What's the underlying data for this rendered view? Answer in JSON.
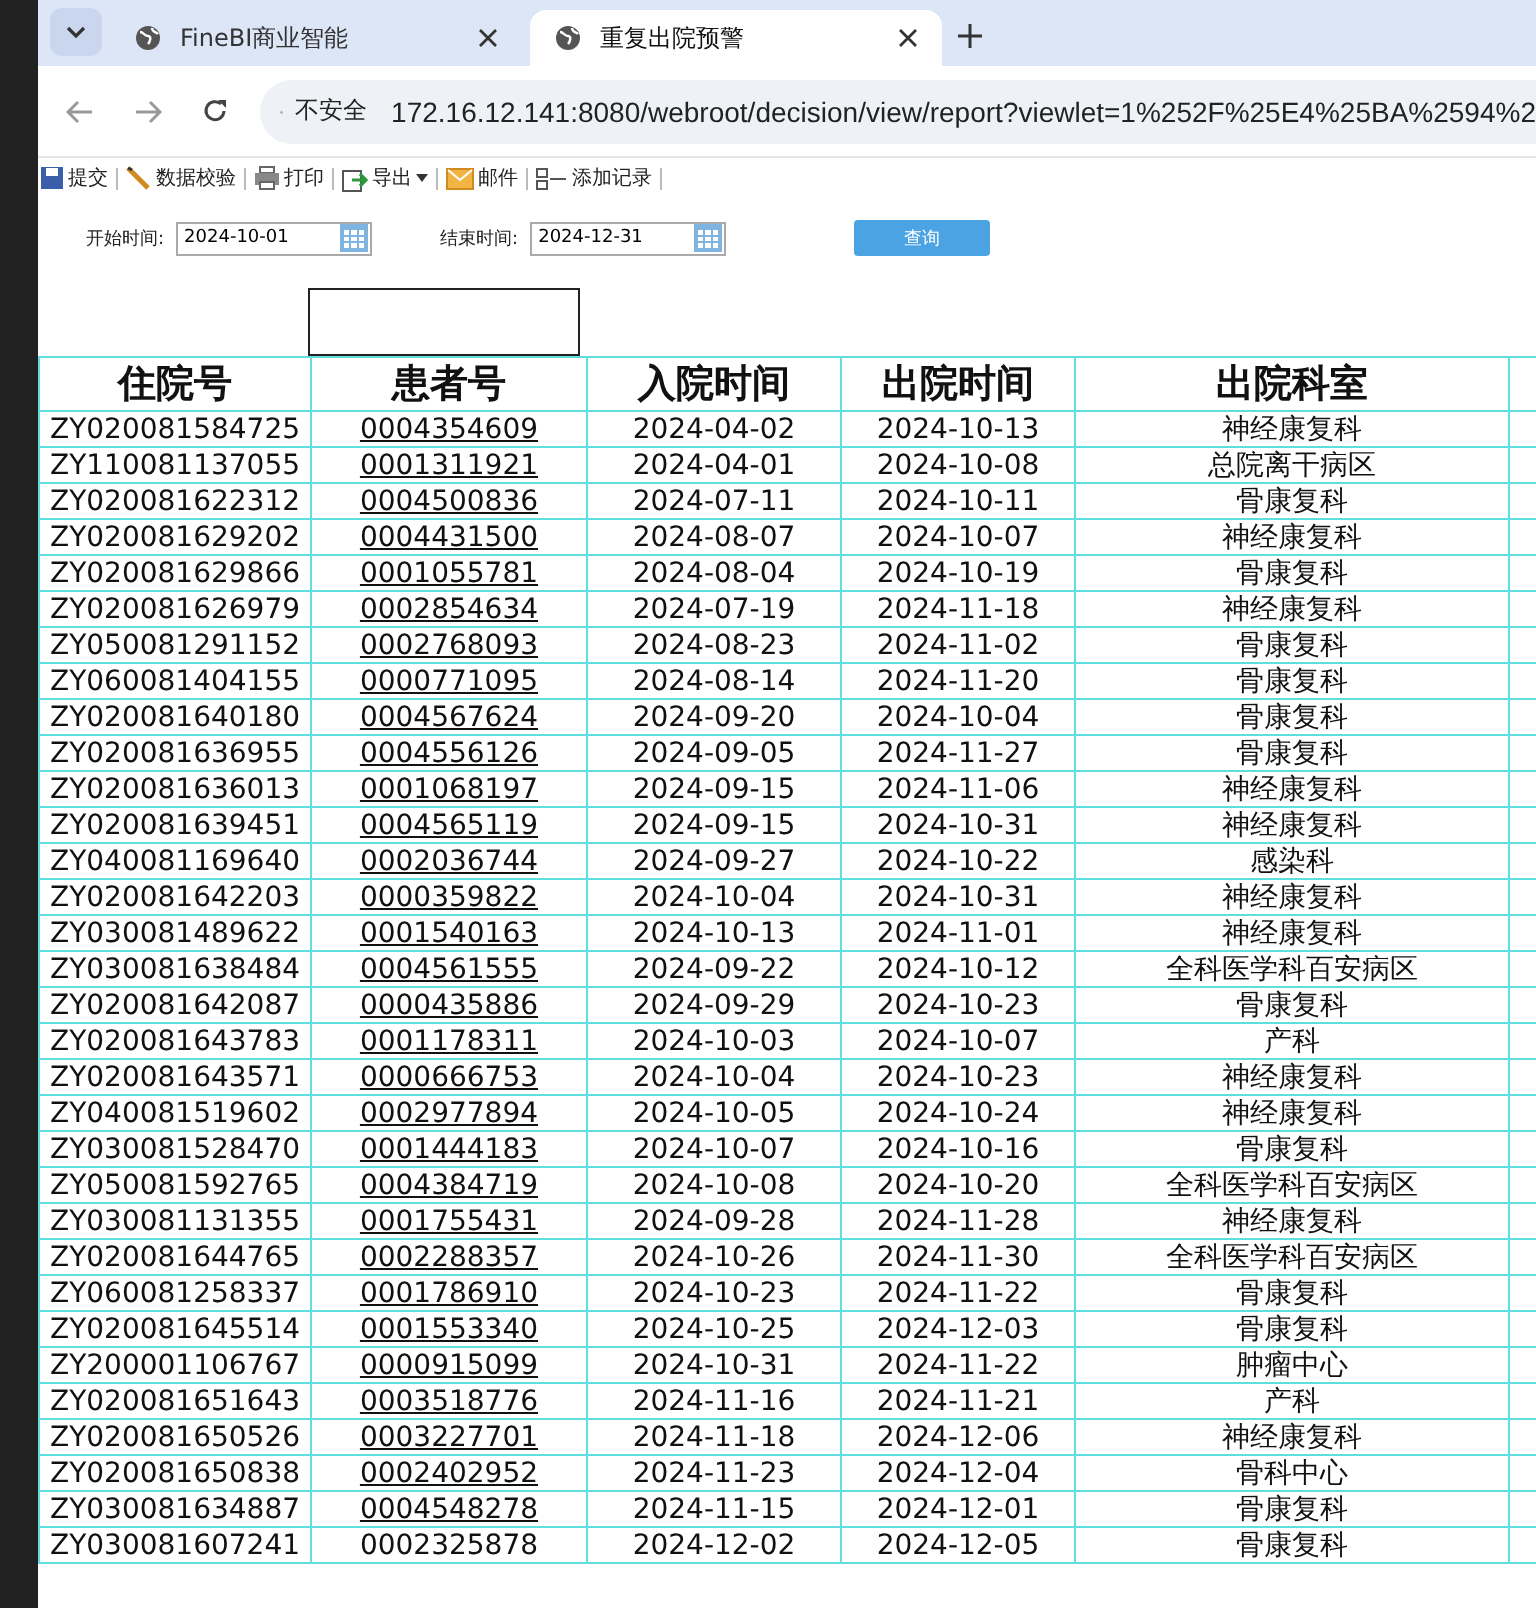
{
  "browser": {
    "tabs": [
      {
        "title": "FineBI商业智能",
        "selected": false
      },
      {
        "title": "重复出院预警",
        "selected": true
      }
    ],
    "security_label": "不安全",
    "url": "172.16.12.141:8080/webroot/decision/view/report?viewlet=1%252F%25E4%25BA%2594%2"
  },
  "toolbar": [
    {
      "kind": "save",
      "label": "提交"
    },
    {
      "kind": "check",
      "label": "数据校验"
    },
    {
      "kind": "print",
      "label": "打印"
    },
    {
      "kind": "export",
      "label": "导出",
      "dropdown": true
    },
    {
      "kind": "mail",
      "label": "邮件"
    },
    {
      "kind": "add",
      "label": "添加记录"
    }
  ],
  "filters": [
    {
      "label": "开始时间:",
      "value": "2024-10-01"
    },
    {
      "label": "结束时间:",
      "value": "2024-12-31"
    }
  ],
  "query_button": "查询",
  "table": {
    "columns": [
      "住院号",
      "患者号",
      "入院时间",
      "出院时间",
      "出院科室"
    ],
    "rows": [
      {
        "cells": [
          "ZY020081584725",
          "0004354609",
          "2024-04-02",
          "2024-10-13",
          "神经康复科"
        ],
        "linked": true
      },
      {
        "cells": [
          "ZY110081137055",
          "0001311921",
          "2024-04-01",
          "2024-10-08",
          "总院离干病区"
        ],
        "linked": true
      },
      {
        "cells": [
          "ZY020081622312",
          "0004500836",
          "2024-07-11",
          "2024-10-11",
          "骨康复科"
        ],
        "linked": true
      },
      {
        "cells": [
          "ZY020081629202",
          "0004431500",
          "2024-08-07",
          "2024-10-07",
          "神经康复科"
        ],
        "linked": true
      },
      {
        "cells": [
          "ZY020081629866",
          "0001055781",
          "2024-08-04",
          "2024-10-19",
          "骨康复科"
        ],
        "linked": true
      },
      {
        "cells": [
          "ZY020081626979",
          "0002854634",
          "2024-07-19",
          "2024-11-18",
          "神经康复科"
        ],
        "linked": true
      },
      {
        "cells": [
          "ZY050081291152",
          "0002768093",
          "2024-08-23",
          "2024-11-02",
          "骨康复科"
        ],
        "linked": true
      },
      {
        "cells": [
          "ZY060081404155",
          "0000771095",
          "2024-08-14",
          "2024-11-20",
          "骨康复科"
        ],
        "linked": true
      },
      {
        "cells": [
          "ZY020081640180",
          "0004567624",
          "2024-09-20",
          "2024-10-04",
          "骨康复科"
        ],
        "linked": true
      },
      {
        "cells": [
          "ZY020081636955",
          "0004556126",
          "2024-09-05",
          "2024-11-27",
          "骨康复科"
        ],
        "linked": true
      },
      {
        "cells": [
          "ZY020081636013",
          "0001068197",
          "2024-09-15",
          "2024-11-06",
          "神经康复科"
        ],
        "linked": true
      },
      {
        "cells": [
          "ZY020081639451",
          "0004565119",
          "2024-09-15",
          "2024-10-31",
          "神经康复科"
        ],
        "linked": true
      },
      {
        "cells": [
          "ZY040081169640",
          "0002036744",
          "2024-09-27",
          "2024-10-22",
          "感染科"
        ],
        "linked": true
      },
      {
        "cells": [
          "ZY020081642203",
          "0000359822",
          "2024-10-04",
          "2024-10-31",
          "神经康复科"
        ],
        "linked": true
      },
      {
        "cells": [
          "ZY030081489622",
          "0001540163",
          "2024-10-13",
          "2024-11-01",
          "神经康复科"
        ],
        "linked": true
      },
      {
        "cells": [
          "ZY030081638484",
          "0004561555",
          "2024-09-22",
          "2024-10-12",
          "全科医学科百安病区"
        ],
        "linked": true
      },
      {
        "cells": [
          "ZY020081642087",
          "0000435886",
          "2024-09-29",
          "2024-10-23",
          "骨康复科"
        ],
        "linked": true
      },
      {
        "cells": [
          "ZY020081643783",
          "0001178311",
          "2024-10-03",
          "2024-10-07",
          "产科"
        ],
        "linked": true
      },
      {
        "cells": [
          "ZY020081643571",
          "0000666753",
          "2024-10-04",
          "2024-10-23",
          "神经康复科"
        ],
        "linked": true
      },
      {
        "cells": [
          "ZY040081519602",
          "0002977894",
          "2024-10-05",
          "2024-10-24",
          "神经康复科"
        ],
        "linked": true
      },
      {
        "cells": [
          "ZY030081528470",
          "0001444183",
          "2024-10-07",
          "2024-10-16",
          "骨康复科"
        ],
        "linked": true
      },
      {
        "cells": [
          "ZY050081592765",
          "0004384719",
          "2024-10-08",
          "2024-10-20",
          "全科医学科百安病区"
        ],
        "linked": true
      },
      {
        "cells": [
          "ZY030081131355",
          "0001755431",
          "2024-09-28",
          "2024-11-28",
          "神经康复科"
        ],
        "linked": true
      },
      {
        "cells": [
          "ZY020081644765",
          "0002288357",
          "2024-10-26",
          "2024-11-30",
          "全科医学科百安病区"
        ],
        "linked": true
      },
      {
        "cells": [
          "ZY060081258337",
          "0001786910",
          "2024-10-23",
          "2024-11-22",
          "骨康复科"
        ],
        "linked": true
      },
      {
        "cells": [
          "ZY020081645514",
          "0001553340",
          "2024-10-25",
          "2024-12-03",
          "骨康复科"
        ],
        "linked": true
      },
      {
        "cells": [
          "ZY200001106767",
          "0000915099",
          "2024-10-31",
          "2024-11-22",
          "肿瘤中心"
        ],
        "linked": true
      },
      {
        "cells": [
          "ZY020081651643",
          "0003518776",
          "2024-11-16",
          "2024-11-21",
          "产科"
        ],
        "linked": true
      },
      {
        "cells": [
          "ZY020081650526",
          "0003227701",
          "2024-11-18",
          "2024-12-06",
          "神经康复科"
        ],
        "linked": true
      },
      {
        "cells": [
          "ZY020081650838",
          "0002402952",
          "2024-11-23",
          "2024-12-04",
          "骨科中心"
        ],
        "linked": true
      },
      {
        "cells": [
          "ZY030081634887",
          "0004548278",
          "2024-11-15",
          "2024-12-01",
          "骨康复科"
        ],
        "linked": true
      },
      {
        "cells": [
          "ZY030081607241",
          "0002325878",
          "2024-12-02",
          "2024-12-05",
          "骨康复科"
        ],
        "linked": false
      }
    ]
  }
}
